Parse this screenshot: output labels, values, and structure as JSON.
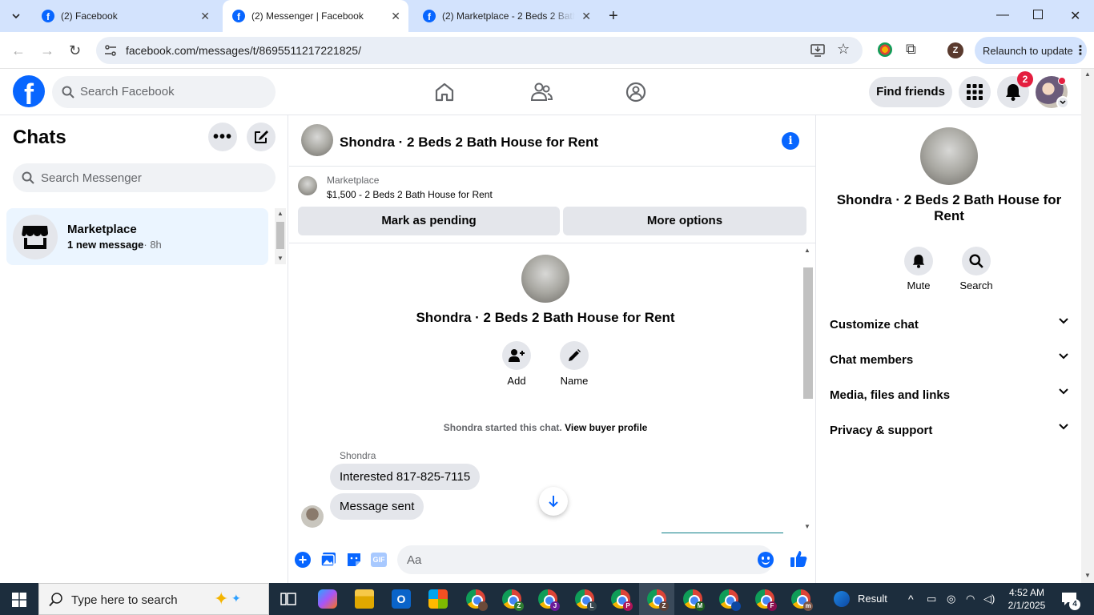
{
  "browser": {
    "tabs": [
      {
        "title": "(2) Facebook",
        "active": false
      },
      {
        "title": "(2) Messenger | Facebook",
        "active": true
      },
      {
        "title": "(2) Marketplace - 2 Beds 2 Bath",
        "active": false
      }
    ],
    "url": "facebook.com/messages/t/8695511217221825/",
    "relaunch_label": "Relaunch to update",
    "profile_initial": "Z"
  },
  "fb_header": {
    "search_placeholder": "Search Facebook",
    "find_friends_label": "Find friends",
    "notification_count": "2"
  },
  "chats": {
    "title": "Chats",
    "search_placeholder": "Search Messenger",
    "items": [
      {
        "name": "Marketplace",
        "preview": "1 new message",
        "time": "· 8h"
      }
    ]
  },
  "conversation": {
    "title": "Shondra · 2 Beds 2 Bath House for Rent",
    "marketplace_label": "Marketplace",
    "listing": "$1,500 - 2 Beds 2 Bath House for Rent",
    "mark_pending_label": "Mark as pending",
    "more_options_label": "More options",
    "intro_title": "Shondra · 2 Beds 2 Bath House for Rent",
    "add_label": "Add",
    "name_label": "Name",
    "started_text": "Shondra started this chat.",
    "view_buyer_label": "View buyer profile",
    "sender_name": "Shondra",
    "messages": [
      {
        "text": "Interested 817-825-7115"
      },
      {
        "text": "Message sent"
      }
    ],
    "composer_placeholder": "Aa"
  },
  "details": {
    "title": "Shondra · 2 Beds 2 Bath House for Rent",
    "mute_label": "Mute",
    "search_label": "Search",
    "sections": [
      "Customize chat",
      "Chat members",
      "Media, files and links",
      "Privacy & support"
    ]
  },
  "taskbar": {
    "search_placeholder": "Type here to search",
    "weather_label": "Result",
    "time": "4:52 AM",
    "date": "2/1/2025",
    "notification_count": "4",
    "chrome_profiles": [
      "Z",
      "J",
      "L",
      "P",
      "Z",
      "M",
      "F",
      "m"
    ]
  },
  "colors": {
    "fb_blue": "#0866ff",
    "tab_strip": "#d3e3fd",
    "selected_chat": "#ebf5ff",
    "button_gray": "#e4e6eb"
  }
}
